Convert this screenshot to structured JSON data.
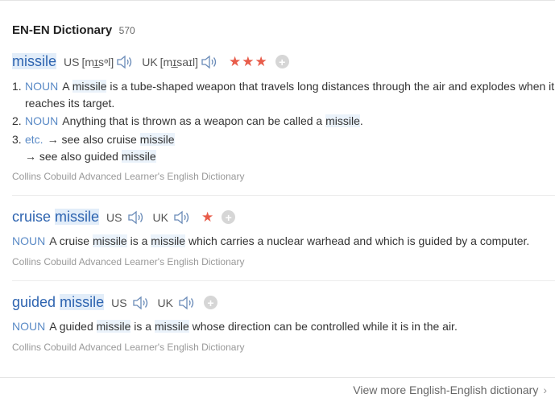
{
  "header": {
    "title": "EN-EN Dictionary",
    "count": "570"
  },
  "entries": [
    {
      "word_parts": [
        "missile"
      ],
      "us_label": "US",
      "us_ipa": "[mɪ̲sᵊl]",
      "uk_label": "UK",
      "uk_ipa": "[mɪ̲saɪl]",
      "stars": "★★★",
      "senses": [
        {
          "num": "1.",
          "pos": "NOUN",
          "pre": "A ",
          "hl": "missile",
          "post": " is a tube-shaped weapon that travels long distances through the air and explodes when it",
          "cont": "reaches its target."
        },
        {
          "num": "2.",
          "pos": "NOUN",
          "pre": "Anything that is thrown as a weapon can be called a ",
          "hl": "missile",
          "post": "."
        },
        {
          "num": "3.",
          "pos": "etc.",
          "pre": "→ see also cruise ",
          "hl": "missile",
          "post": "",
          "cont_pre": "→ see also guided ",
          "cont_hl": "missile"
        }
      ],
      "source": "Collins Cobuild Advanced Learner's English Dictionary"
    },
    {
      "word_parts": [
        "cruise",
        "missile"
      ],
      "us_label": "US",
      "uk_label": "UK",
      "stars": "★",
      "sense": {
        "pos": "NOUN",
        "t1": "A cruise ",
        "h1": "missile",
        "t2": " is a ",
        "h2": "missile",
        "t3": " which carries a nuclear warhead and which is guided by a computer."
      },
      "source": "Collins Cobuild Advanced Learner's English Dictionary"
    },
    {
      "word_parts": [
        "guided",
        "missile"
      ],
      "us_label": "US",
      "uk_label": "UK",
      "sense": {
        "pos": "NOUN",
        "t1": "A guided ",
        "h1": "missile",
        "t2": " is a ",
        "h2": "missile",
        "t3": " whose direction can be controlled while it is in the air."
      },
      "source": "Collins Cobuild Advanced Learner's English Dictionary"
    }
  ],
  "footer": {
    "view_more": "View more English-English dictionary",
    "chevron": "›"
  },
  "icons": {
    "speaker": "speaker-icon",
    "plus": "add-wordbook-icon"
  },
  "colors": {
    "word": "#2e64b0",
    "pos": "#5a8ac6",
    "stars": "#e85c4a",
    "highlight": "#ebf3fb"
  }
}
